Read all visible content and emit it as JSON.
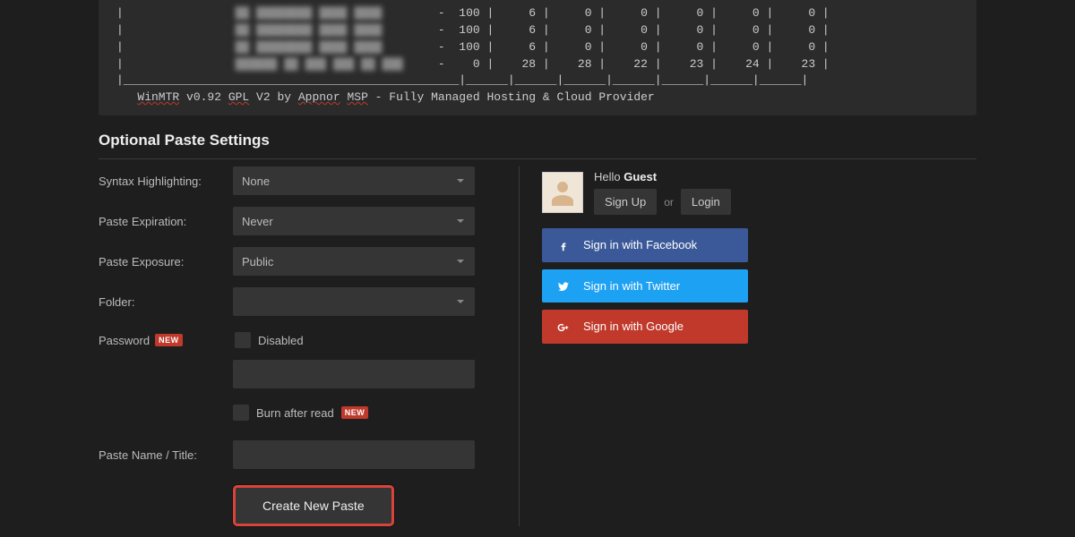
{
  "code_lines": [
    {
      "host": "██ ████████ ████ ████",
      "blur": true,
      "sep": "-",
      "cols": [
        "100",
        "6",
        "0",
        "0",
        "0",
        "0",
        "0"
      ]
    },
    {
      "host": "██ ████████ ████ ████",
      "blur": true,
      "sep": "-",
      "cols": [
        "100",
        "6",
        "0",
        "0",
        "0",
        "0",
        "0"
      ]
    },
    {
      "host": "██ ████████ ████ ████",
      "blur": true,
      "sep": "-",
      "cols": [
        "100",
        "6",
        "0",
        "0",
        "0",
        "0",
        "0"
      ]
    },
    {
      "host": "██████ ██ ███ ███ ██ ███",
      "blur": true,
      "sep": "-",
      "cols": [
        "0",
        "28",
        "28",
        "22",
        "23",
        "24",
        "23"
      ]
    }
  ],
  "footer_line": {
    "a": "WinMTR",
    "b": " v0.92 ",
    "c": "GPL",
    "d": " V2 by ",
    "e": "Appnor",
    "f": " ",
    "g": "MSP",
    "h": " - Fully Managed Hosting & Cloud Provider"
  },
  "section_title": "Optional Paste Settings",
  "form": {
    "syntax": {
      "label": "Syntax Highlighting:",
      "value": "None"
    },
    "expiration": {
      "label": "Paste Expiration:",
      "value": "Never"
    },
    "exposure": {
      "label": "Paste Exposure:",
      "value": "Public"
    },
    "folder": {
      "label": "Folder:",
      "value": ""
    },
    "password": {
      "label": "Password",
      "badge": "NEW",
      "disabled_label": "Disabled"
    },
    "burn": {
      "label": "Burn after read",
      "badge": "NEW"
    },
    "title": {
      "label": "Paste Name / Title:",
      "value": ""
    },
    "submit": "Create New Paste"
  },
  "sidebar": {
    "hello": "Hello ",
    "guest": "Guest",
    "signup": "Sign Up",
    "or": "or",
    "login": "Login",
    "fb": "Sign in with Facebook",
    "tw": "Sign in with Twitter",
    "gp": "Sign in with Google"
  }
}
